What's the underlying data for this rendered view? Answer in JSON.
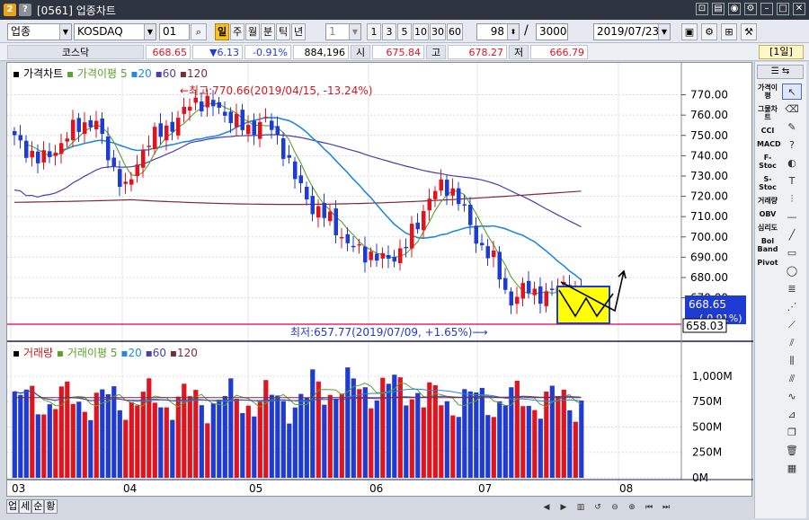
{
  "window": {
    "code": "[0561]",
    "title": "업종차트",
    "icon_primary": "2",
    "icon_secondary": "?"
  },
  "toolbar": {
    "market_select": "업종",
    "market_code": "KOSDAQ",
    "sub_code": "01",
    "periods": [
      "일",
      "주",
      "월",
      "분",
      "틱",
      "년"
    ],
    "active_period": "일",
    "interval_value": "1",
    "quick_intervals": [
      "1",
      "3",
      "5",
      "10",
      "30",
      "60"
    ],
    "view_count": "98",
    "total_count": "3000",
    "date": "2019/07/23"
  },
  "pricebar": {
    "name": "코스닥",
    "price": "668.65",
    "change": "▼6.13",
    "change_pct": "-0.91%",
    "volume": "884,196",
    "open_label": "시",
    "open": "675.84",
    "high_label": "고",
    "high": "678.27",
    "low_label": "저",
    "low": "666.79",
    "period_badge": "[1일]"
  },
  "price_panel": {
    "title": "가격차트",
    "ma_label": "가격이평",
    "ma_periods": [
      "5",
      "20",
      "60",
      "120"
    ],
    "high_note": "←최고:770.66(2019/04/15, -13.24%)",
    "low_note": "최저:657.77(2019/07/09, +1.65%)⟶",
    "current_price_tag": "668.65",
    "current_pct_tag": "(-0.91%)",
    "line_price_tag": "658.03",
    "y_ticks": [
      "770.00",
      "760.00",
      "750.00",
      "740.00",
      "730.00",
      "720.00",
      "710.00",
      "700.00",
      "690.00",
      "680.00",
      "670.00"
    ]
  },
  "volume_panel": {
    "title": "거래량",
    "ma_label": "거래이평",
    "ma_periods": [
      "5",
      "20",
      "60",
      "120"
    ],
    "y_ticks": [
      "1,000M",
      "750M",
      "500M",
      "250M",
      "0M"
    ]
  },
  "x_axis": {
    "labels": [
      "03",
      "04",
      "05",
      "06",
      "07",
      "08"
    ]
  },
  "colors": {
    "up": "#e0141e",
    "down": "#1e3cd2",
    "ma5": "#5aa02c",
    "ma20": "#2389da",
    "ma60": "#4b3fa6",
    "ma120": "#7a2a3c",
    "support_line": "#e8236e",
    "highlight_box": "#ffff00"
  },
  "tabs": [
    "업",
    "세",
    "순",
    "황"
  ],
  "sidebar": {
    "indicators": [
      "가격이평",
      "그물차트",
      "CCI",
      "MACD",
      "F-Stoc",
      "S-Stoc",
      "거래량",
      "OBV",
      "심리도",
      "Bol Band",
      "Pivot"
    ]
  },
  "chart_data": {
    "type": "candlestick",
    "price_ylim": [
      653,
      776
    ],
    "volume_ylim": [
      0,
      1150
    ],
    "high": 770.66,
    "low": 657.77,
    "support_level": 658.03,
    "last": 668.65
  }
}
